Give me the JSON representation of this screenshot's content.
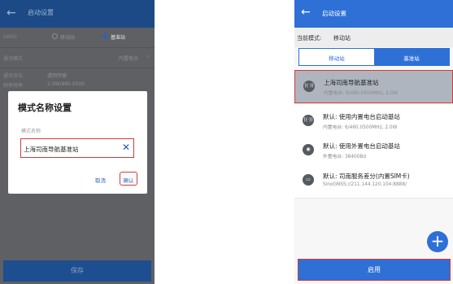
{
  "left": {
    "title": "启动设置",
    "gnss": {
      "label": "GNSS",
      "option_mobile": "移动站",
      "option_base": "基准站"
    },
    "comm_mode": {
      "label": "通讯模式",
      "value": "内置电台"
    },
    "protocol": {
      "label": "通讯协议",
      "value": "透明传输"
    },
    "freq": {
      "label": "频率频率",
      "value": "2.0W/460.0500"
    },
    "save_label": "保存",
    "dialog": {
      "title": "模式名称设置",
      "field_label": "模式名称",
      "input_value": "上海司南导航基准站",
      "cancel_label": "取消",
      "ok_label": "确认"
    }
  },
  "right": {
    "title": "启动设置",
    "current_mode": {
      "label": "当前模式:",
      "value": "移动站"
    },
    "tabs": {
      "mobile": "移动站",
      "base": "基准站"
    },
    "items": [
      {
        "icon": "radio-signal-icon",
        "title": "上海司南导航基准站",
        "sub": "内置电台: 6/460.0500MHz, 2.0W"
      },
      {
        "icon": "radio-signal-icon",
        "title": "默认: 使用内置电台启动基站",
        "sub": "内置电台: 6/460.0500MHz, 2.0W"
      },
      {
        "icon": "external-radio-icon",
        "title": "默认: 使用外置电台启动基站",
        "sub": "外置电台: 38400Bd"
      },
      {
        "icon": "sim-network-icon",
        "title": "默认: 司南服务差分(内置SIM卡)",
        "sub": "SinoGNSS://211.144.120.104:8888/"
      }
    ],
    "fab_label": "+",
    "start_label": "启用"
  }
}
